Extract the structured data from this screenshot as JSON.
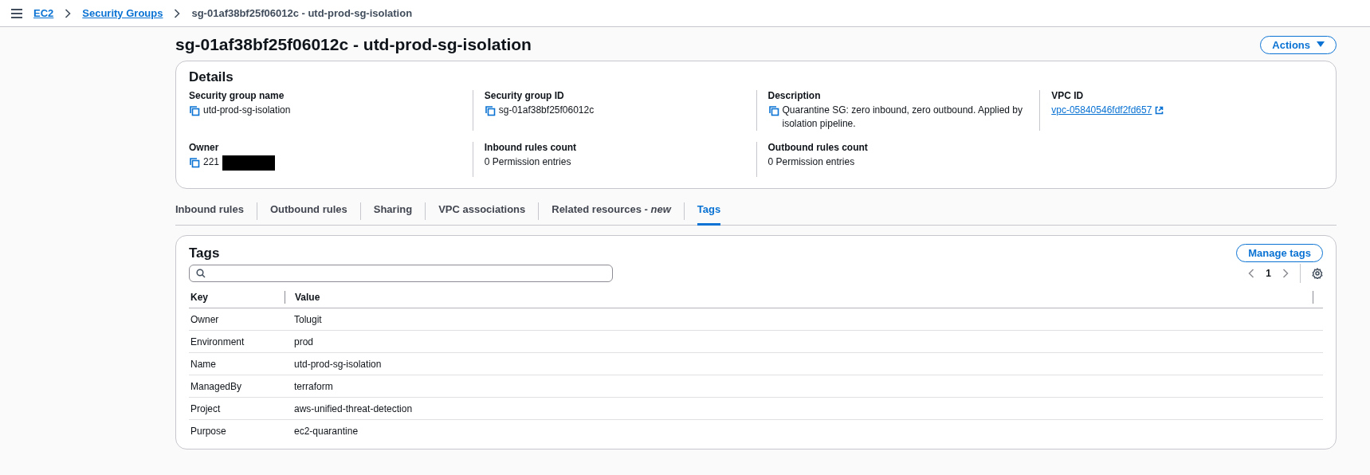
{
  "breadcrumbs": [
    {
      "label": "EC2",
      "link": true
    },
    {
      "label": "Security Groups",
      "link": true
    },
    {
      "label": "sg-01af38bf25f06012c - utd-prod-sg-isolation",
      "link": false
    }
  ],
  "page_title": "sg-01af38bf25f06012c - utd-prod-sg-isolation",
  "actions_button": "Actions",
  "details": {
    "title": "Details",
    "fields": [
      {
        "label": "Security group name",
        "value": "utd-prod-sg-isolation",
        "kind": "copy"
      },
      {
        "label": "Security group ID",
        "value": "sg-01af38bf25f06012c",
        "kind": "copy"
      },
      {
        "label": "Description",
        "value": "Quarantine SG: zero inbound, zero outbound. Applied by isolation pipeline.",
        "kind": "copy"
      },
      {
        "label": "VPC ID",
        "value": "vpc-05840546fdf2fd657",
        "kind": "link"
      },
      {
        "label": "Owner",
        "value": "221",
        "kind": "redacted"
      },
      {
        "label": "Inbound rules count",
        "value": "0 Permission entries",
        "kind": "plain"
      },
      {
        "label": "Outbound rules count",
        "value": "0 Permission entries",
        "kind": "plain"
      }
    ]
  },
  "tabs": [
    {
      "label": "Inbound rules",
      "selected": false
    },
    {
      "label": "Outbound rules",
      "selected": false
    },
    {
      "label": "Sharing",
      "selected": false
    },
    {
      "label": "VPC associations",
      "selected": false
    },
    {
      "label": "Related resources - *new*",
      "selected": false
    },
    {
      "label": "Tags",
      "selected": true
    }
  ],
  "tags": {
    "title": "Tags",
    "manage_button": "Manage tags",
    "page": "1",
    "columns": [
      "Key",
      "Value"
    ],
    "rows": [
      [
        "Owner",
        "Tolugit"
      ],
      [
        "Environment",
        "prod"
      ],
      [
        "Name",
        "utd-prod-sg-isolation"
      ],
      [
        "ManagedBy",
        "terraform"
      ],
      [
        "Project",
        "aws-unified-threat-detection"
      ],
      [
        "Purpose",
        "ec2-quarantine"
      ]
    ]
  }
}
